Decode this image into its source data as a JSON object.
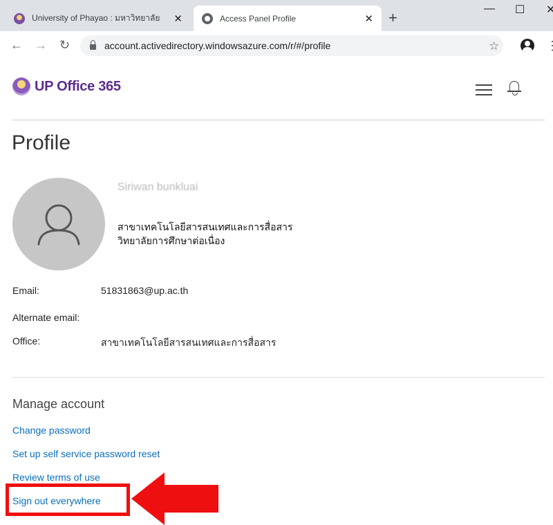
{
  "browser": {
    "tabs": [
      {
        "title": "University of Phayao : มหาวิทยาลัย",
        "active": false
      },
      {
        "title": "Access Panel Profile",
        "active": true
      }
    ],
    "new_tab_symbol": "+",
    "address": "account.activedirectory.windowsazure.com/r/#/profile",
    "icons": [
      "back-icon",
      "forward-icon",
      "reload-icon",
      "lock-icon",
      "star-icon",
      "account-icon",
      "menu-icon"
    ]
  },
  "header": {
    "brand": "UP Office 365",
    "brand_color": "#5b2d90",
    "icons": [
      "hamburger-menu-icon",
      "bell-icon"
    ]
  },
  "profile": {
    "title": "Profile",
    "name": "Siriwan bunkluai",
    "department_line1": "สาขาเทคโนโลยีสารสนเทศและการสื่อสาร",
    "department_line2": "วิทยาลัยการศึกษาต่อเนื่อง",
    "fields": {
      "email_label": "Email:",
      "email_value": "51831863@up.ac.th",
      "alternate_email_label": "Alternate email:",
      "alternate_email_value": "",
      "office_label": "Office:",
      "office_value": "สาขาเทคโนโลยีสารสนเทศและการสื่อสาร"
    }
  },
  "manage": {
    "title": "Manage account",
    "links": {
      "change_password": "Change password",
      "sspr": "Set up self service password reset",
      "terms": "Review terms of use",
      "sign_out": "Sign out everywhere"
    },
    "link_color": "#0a6ebd"
  },
  "annotation": {
    "color": "#ee1010",
    "target": "Sign out everywhere"
  }
}
